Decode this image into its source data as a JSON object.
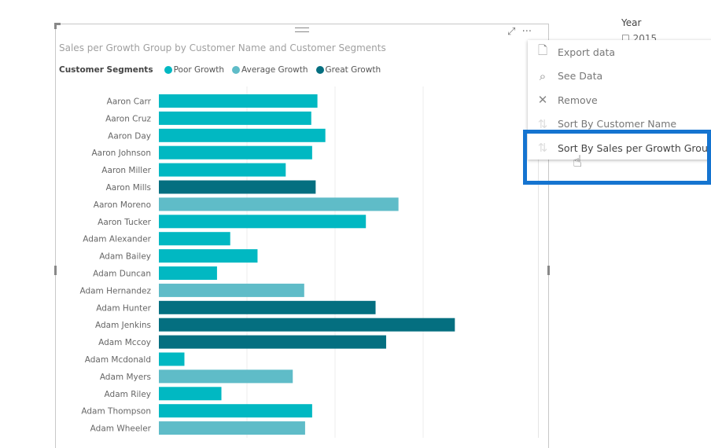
{
  "visual": {
    "title": "Sales per Growth Group by Customer Name and Customer Segments",
    "legend_title": "Customer Segments"
  },
  "header_icons": {
    "focus": "focus-mode-icon",
    "more": "more-options-icon"
  },
  "slicer": {
    "title": "Year",
    "option": "2015"
  },
  "context_menu": {
    "items": [
      {
        "label": "Export data",
        "icon": "export-icon"
      },
      {
        "label": "See Data",
        "icon": "see-data-icon"
      },
      {
        "label": "Remove",
        "icon": "close-icon"
      },
      {
        "label": "Sort By Customer Name",
        "icon": "sort-icon"
      },
      {
        "label": "Sort By Sales per Growth Group",
        "icon": "sort-icon",
        "highlighted": true
      }
    ]
  },
  "chart_data": {
    "type": "bar",
    "orientation": "horizontal",
    "title": "Sales per Growth Group by Customer Name and Customer Segments",
    "legend_placement": "top-left",
    "grid": true,
    "series": [
      {
        "name": "Poor Growth",
        "color": "#01b8c2"
      },
      {
        "name": "Average Growth",
        "color": "#5fbcc8"
      },
      {
        "name": "Great Growth",
        "color": "#046f80"
      }
    ],
    "categories": [
      "Aaron Carr",
      "Aaron Cruz",
      "Aaron Day",
      "Aaron Johnson",
      "Aaron Miller",
      "Aaron Mills",
      "Aaron Moreno",
      "Aaron Tucker",
      "Adam Alexander",
      "Adam Bailey",
      "Adam Duncan",
      "Adam Hernandez",
      "Adam Hunter",
      "Adam Jenkins",
      "Adam Mccoy",
      "Adam Mcdonald",
      "Adam Myers",
      "Adam Riley",
      "Adam Thompson",
      "Adam Wheeler"
    ],
    "values": [
      1.8,
      1.73,
      1.89,
      1.74,
      1.44,
      1.78,
      2.72,
      2.35,
      0.81,
      1.12,
      0.66,
      1.65,
      2.46,
      3.36,
      2.58,
      0.29,
      1.52,
      0.71,
      1.74,
      1.66
    ],
    "segments": [
      "Poor Growth",
      "Poor Growth",
      "Poor Growth",
      "Poor Growth",
      "Poor Growth",
      "Great Growth",
      "Average Growth",
      "Poor Growth",
      "Poor Growth",
      "Poor Growth",
      "Poor Growth",
      "Average Growth",
      "Great Growth",
      "Great Growth",
      "Great Growth",
      "Poor Growth",
      "Average Growth",
      "Poor Growth",
      "Poor Growth",
      "Average Growth"
    ]
  }
}
